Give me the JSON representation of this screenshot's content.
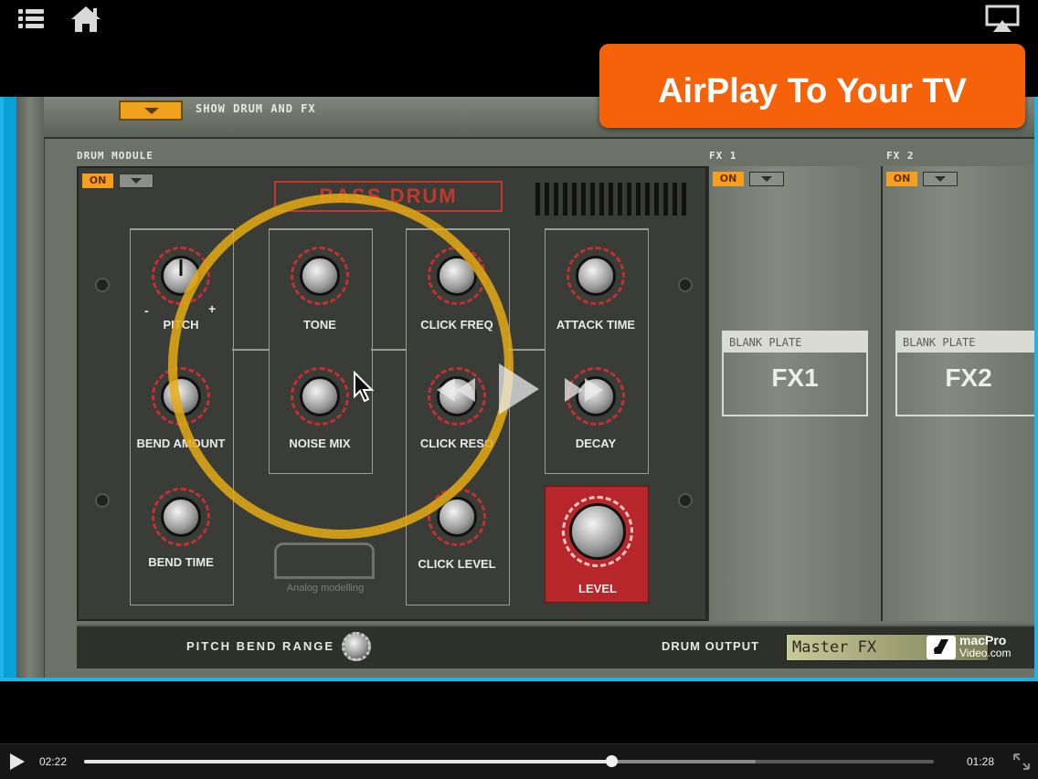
{
  "top_bar": {
    "menu_icon": "list-icon",
    "home_icon": "home-icon",
    "airplay_icon": "airplay-icon"
  },
  "airplay_banner": {
    "text": "AirPlay To Your TV"
  },
  "video": {
    "show_button_label": "SHOW DRUM AND FX",
    "drum_module_label": "DRUM MODULE",
    "fx1_label": "FX 1",
    "fx2_label": "FX 2",
    "on_label": "ON",
    "title_plate": "BASS DRUM",
    "knobs": {
      "pitch": "PITCH",
      "tone": "TONE",
      "click_freq": "CLICK FREQ",
      "attack_time": "ATTACK TIME",
      "bend_amount": "BEND AMOUNT",
      "noise_mix": "NOISE MIX",
      "click_reso": "CLICK RESO",
      "decay": "DECAY",
      "bend_time": "BEND TIME",
      "click_level": "CLICK LEVEL",
      "level": "LEVEL"
    },
    "pitch_minus": "-",
    "pitch_plus": "+",
    "logo_text": "Analog modelling",
    "fx1_plate": {
      "caption": "BLANK PLATE",
      "title": "FX1"
    },
    "fx2_plate": {
      "caption": "BLANK PLATE",
      "title": "FX2"
    },
    "pitch_bend_range": "PITCH BEND RANGE",
    "drum_output": "DRUM OUTPUT",
    "output_value": "Master FX",
    "watermark": {
      "line1": "macPro",
      "line2": "Video.com"
    }
  },
  "player": {
    "play_icon": "play-icon",
    "elapsed": "02:22",
    "remaining": "01:28",
    "progress": 0.62,
    "buffered": 0.79,
    "fullscreen_icon": "expand-icon",
    "overlay_rewind_icon": "rewind-icon",
    "overlay_play_icon": "play-icon",
    "overlay_forward_icon": "fast-forward-icon"
  }
}
